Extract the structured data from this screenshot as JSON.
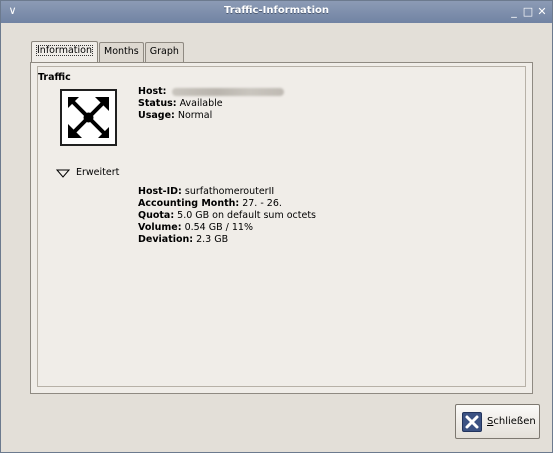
{
  "window": {
    "title": "Traffic-Information",
    "menu_glyph": "∨",
    "minimize_glyph": "_",
    "maximize_glyph": "□",
    "close_glyph": "✕"
  },
  "tabs": [
    {
      "label": "Information",
      "active": true
    },
    {
      "label": "Months",
      "active": false
    },
    {
      "label": "Graph",
      "active": false
    }
  ],
  "information": {
    "section_title": "Traffic",
    "device_icon": "network-device-icon",
    "host_label": "Host:",
    "host_value": "",
    "status_label": "Status:",
    "status_value": "Available",
    "usage_label": "Usage:",
    "usage_value": "Normal",
    "expander_label": "Erweitert",
    "host_id_label": "Host-ID:",
    "host_id_value": "surfathomerouterII",
    "accounting_month_label": "Accounting Month:",
    "accounting_month_value": "27. - 26.",
    "quota_label": "Quota:",
    "quota_value": "5.0 GB on default sum octets",
    "volume_label": "Volume:",
    "volume_value": "0.54 GB / 11%",
    "deviation_label": "Deviation:",
    "deviation_value": "2.3 GB"
  },
  "close_button": {
    "label_underlined": "S",
    "label_rest": "chließen",
    "icon": "close-x-icon"
  }
}
